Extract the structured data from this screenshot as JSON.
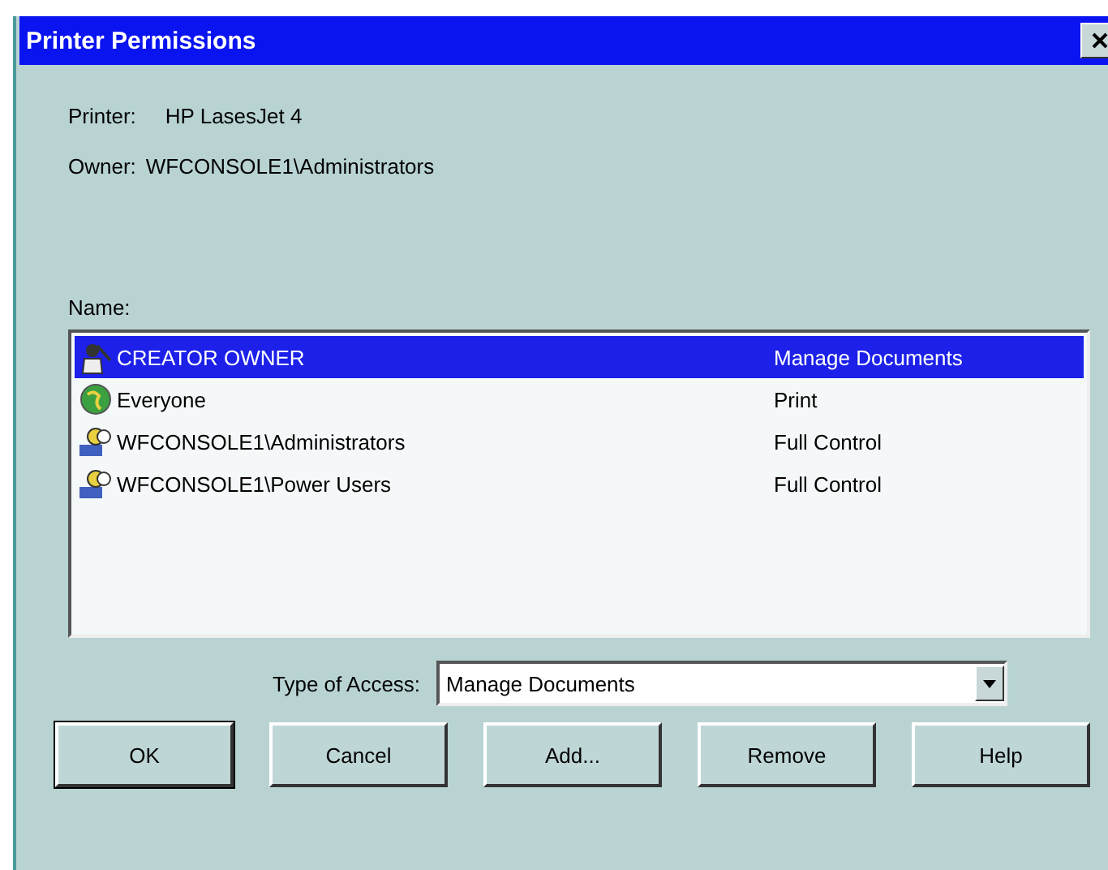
{
  "window": {
    "title": "Printer Permissions"
  },
  "printer": {
    "label": "Printer:",
    "value": "HP LasesJet 4"
  },
  "owner": {
    "label": "Owner:",
    "value": "WFCONSOLE1\\Administrators"
  },
  "names": {
    "label": "Name:",
    "items": [
      {
        "kind": "creator",
        "name": "CREATOR OWNER",
        "access": "Manage Documents",
        "selected": true
      },
      {
        "kind": "globe",
        "name": "Everyone",
        "access": "Print",
        "selected": false
      },
      {
        "kind": "group",
        "name": "WFCONSOLE1\\Administrators",
        "access": "Full Control",
        "selected": false
      },
      {
        "kind": "group",
        "name": "WFCONSOLE1\\Power Users",
        "access": "Full Control",
        "selected": false
      }
    ]
  },
  "type_of_access": {
    "label": "Type of Access:",
    "value": "Manage Documents"
  },
  "buttons": [
    {
      "label": "OK",
      "default": true
    },
    {
      "label": "Cancel",
      "default": false
    },
    {
      "label": "Add...",
      "default": false
    },
    {
      "label": "Remove",
      "default": false
    },
    {
      "label": "Help",
      "default": false
    }
  ]
}
